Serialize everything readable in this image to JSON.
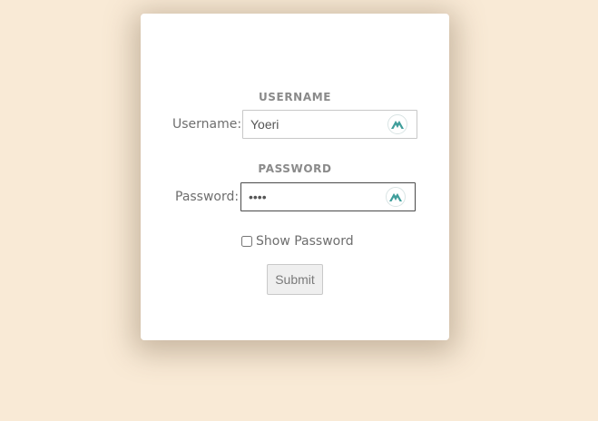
{
  "form": {
    "username_heading": "USERNAME",
    "username_label": "Username:",
    "username_value": "Yoeri",
    "password_heading": "PASSWORD",
    "password_label": "Password:",
    "password_value": "abcd",
    "show_password_label": "Show Password",
    "show_password_checked": false,
    "submit_label": "Submit"
  },
  "icons": {
    "autofill": "nordpass-autofill-icon"
  },
  "colors": {
    "background": "#f9ead6",
    "card": "#ffffff",
    "icon_accent": "#3f9e9b"
  }
}
